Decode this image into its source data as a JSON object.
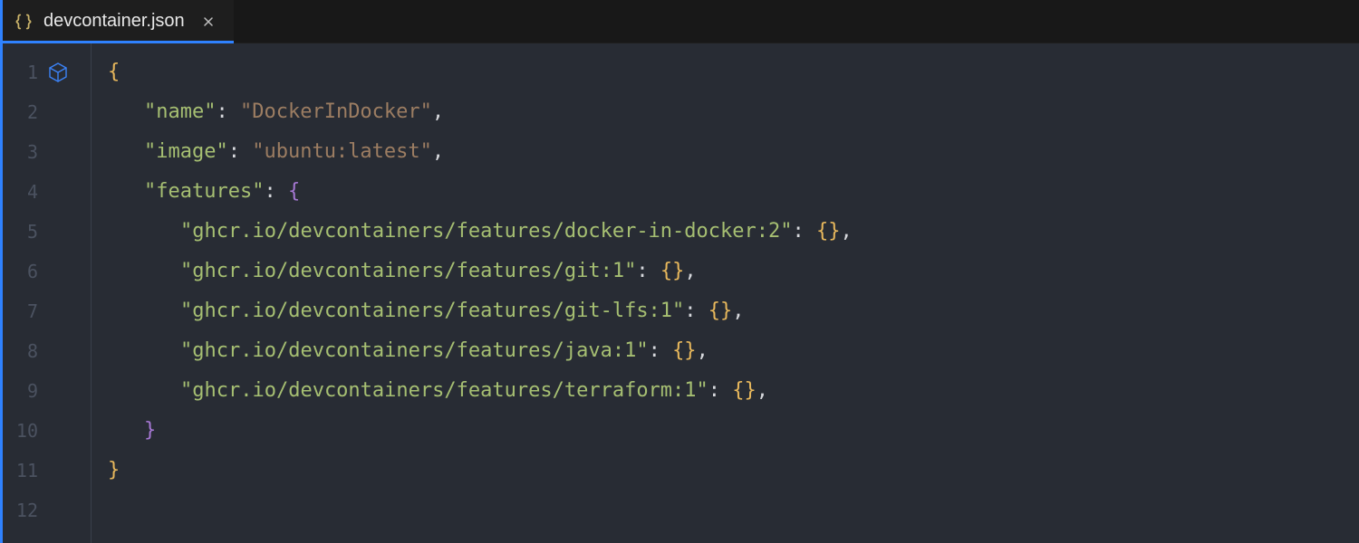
{
  "tab": {
    "filename": "devcontainer.json",
    "icon": "braces-icon",
    "close_label": "×"
  },
  "editor": {
    "gutter_icon": "cube-icon",
    "line_numbers": [
      "1",
      "2",
      "3",
      "4",
      "5",
      "6",
      "7",
      "8",
      "9",
      "10",
      "11",
      "12"
    ],
    "json": {
      "name_key": "\"name\"",
      "name_value": "\"DockerInDocker\"",
      "image_key": "\"image\"",
      "image_value": "\"ubuntu:latest\"",
      "features_key": "\"features\"",
      "features": [
        "\"ghcr.io/devcontainers/features/docker-in-docker:2\"",
        "\"ghcr.io/devcontainers/features/git:1\"",
        "\"ghcr.io/devcontainers/features/git-lfs:1\"",
        "\"ghcr.io/devcontainers/features/java:1\"",
        "\"ghcr.io/devcontainers/features/terraform:1\""
      ]
    }
  }
}
